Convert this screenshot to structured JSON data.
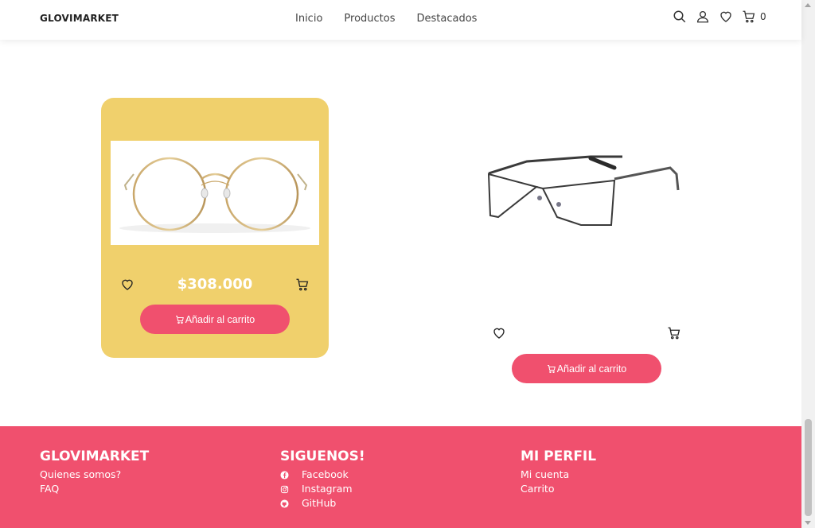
{
  "header": {
    "brand": "GLOVIMARKET",
    "nav": [
      "Inicio",
      "Productos",
      "Destacados"
    ],
    "icons": [
      "search-icon",
      "user-icon",
      "heart-icon",
      "cart-icon"
    ],
    "cart_count": "0"
  },
  "products": [
    {
      "price": "$308.000",
      "image": "gold-round-glasses",
      "add_label": "Añadir al carrito",
      "background": "#f0d06c"
    },
    {
      "price": "",
      "image": "dark-rectangular-glasses",
      "add_label": "Añadir al carrito",
      "background": "#ffffff"
    }
  ],
  "footer": {
    "col1": {
      "title": "GLOVIMARKET",
      "links": [
        "Quienes somos?",
        "FAQ"
      ]
    },
    "col2": {
      "title": "SIGUENOS!",
      "links": [
        "Facebook",
        "Instagram",
        "GitHub"
      ]
    },
    "col3": {
      "title": "MI PERFIL",
      "links": [
        "Mi cuenta",
        "Carrito"
      ]
    }
  },
  "colors": {
    "accent": "#f0506e",
    "card": "#f0d06c"
  }
}
